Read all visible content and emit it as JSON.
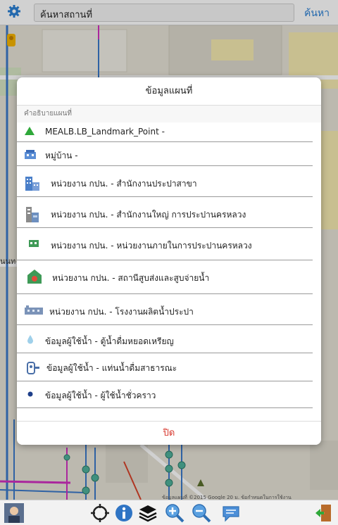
{
  "search": {
    "value": "ค้นหาสถานที่",
    "button_label": "ค้นหา"
  },
  "map": {
    "left_label": "นนท",
    "attribution": "ข้อมูลแผนที่ ©2015 Google   20 ม.   ข้อกำหนดในการใช้งาน"
  },
  "dialog": {
    "title": "ข้อมูลแผนที่",
    "section": "คำอธิบายแผนที่",
    "close_label": "ปิด",
    "items": [
      {
        "label": "MEALB.LB_Landmark_Point -",
        "icon": "green-triangle-icon"
      },
      {
        "label": "หมู่บ้าน -",
        "icon": "village-icon"
      },
      {
        "label": "หน่วยงาน กปน. - สำนักงานประปาสาขา",
        "icon": "branch-office-icon"
      },
      {
        "label": "หน่วยงาน กปน. - สำนักงานใหญ่ การประปานครหลวง",
        "icon": "head-office-icon"
      },
      {
        "label": "หน่วยงาน กปน. - หน่วยงานภายในการประปานครหลวง",
        "icon": "internal-unit-icon"
      },
      {
        "label": "หน่วยงาน กปน. - สถานีสูบส่งและสูบจ่ายน้ำ",
        "icon": "pump-station-icon"
      },
      {
        "label": "หน่วยงาน กปน. - โรงงานผลิตน้ำประปา",
        "icon": "water-plant-icon"
      },
      {
        "label": "ข้อมูลผู้ใช้น้ำ - ตู้น้ำดื่มหยอดเหรียญ",
        "icon": "water-drop-icon"
      },
      {
        "label": "ข้อมูลผู้ใช้น้ำ - แท่นน้ำดื่มสาธารณะ",
        "icon": "drinking-fountain-icon"
      },
      {
        "label": "ข้อมูลผู้ใช้น้ำ - ผู้ใช้น้ำชั่วคราว",
        "icon": "temporary-user-dot-icon"
      }
    ]
  },
  "colors": {
    "accent": "#2a7fd4",
    "close": "#d7372d",
    "pipe_blue": "#3a78c8",
    "pipe_magenta": "#d02fc0"
  }
}
